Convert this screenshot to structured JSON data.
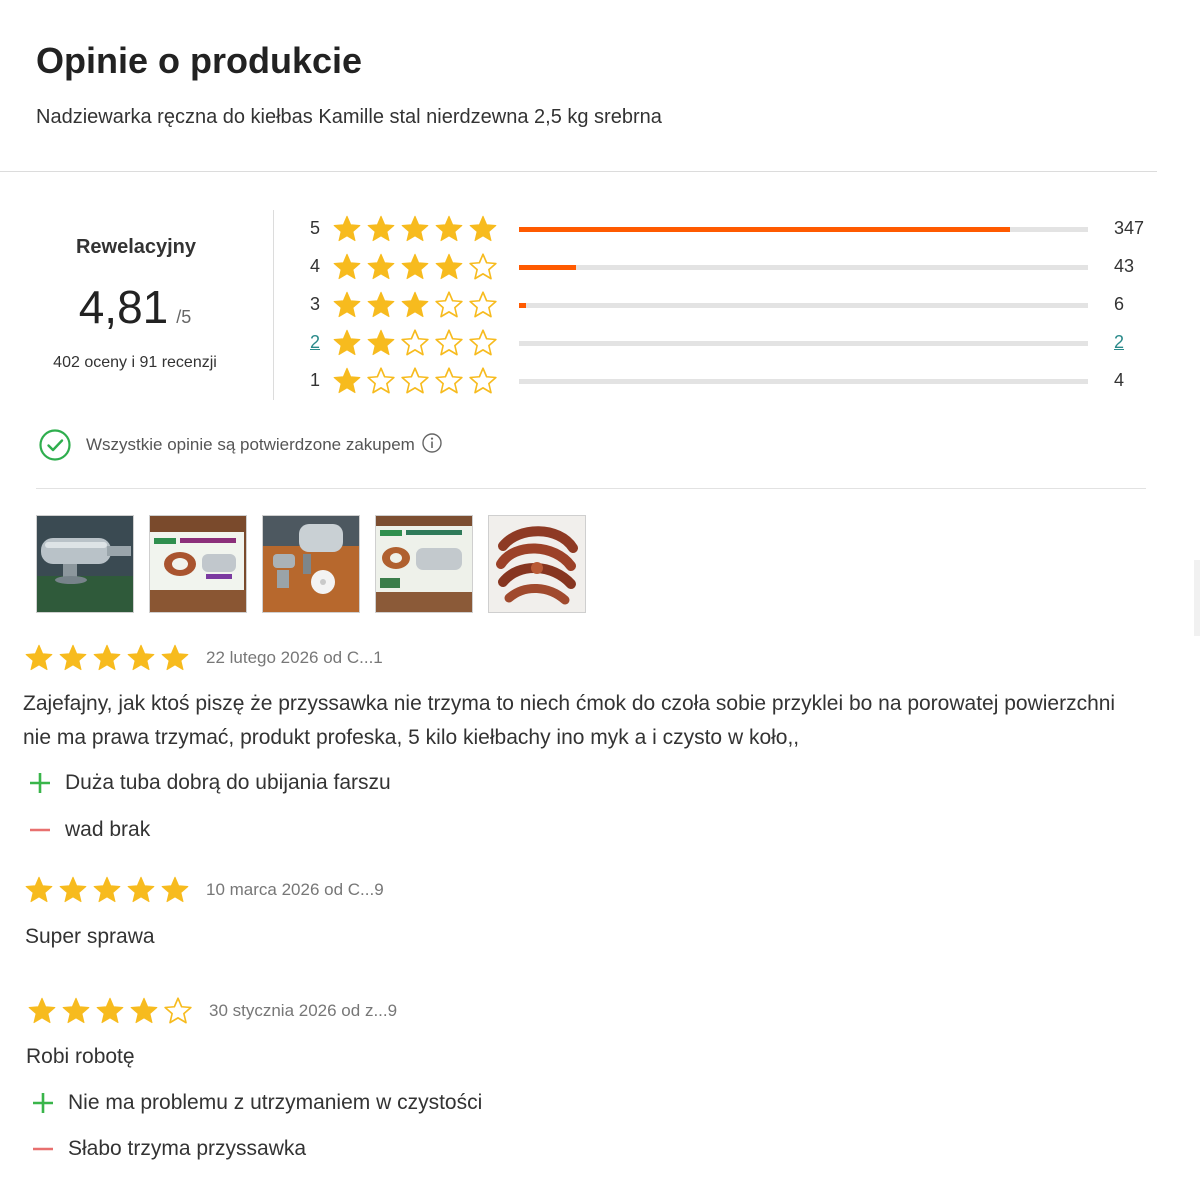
{
  "header": {
    "title": "Opinie o produkcie",
    "product_name": "Nadziewarka ręczna do kiełbas Kamille stal nierdzewna 2,5 kg srebrna"
  },
  "summary": {
    "verdict": "Rewelacyjny",
    "score": "4,81",
    "score_max": "/5",
    "counts": "402 oceny i 91 recenzji"
  },
  "distribution": [
    {
      "stars": 5,
      "label": "5",
      "count": "347",
      "share": 0.863
    },
    {
      "stars": 4,
      "label": "4",
      "count": "43",
      "share": 0.1
    },
    {
      "stars": 3,
      "label": "3",
      "count": "6",
      "share": 0.012
    },
    {
      "stars": 2,
      "label": "2",
      "count": "2",
      "share": 0.0,
      "linked": true
    },
    {
      "stars": 1,
      "label": "1",
      "count": "4",
      "share": 0.0
    }
  ],
  "verified": {
    "text": "Wszystkie opinie są potwierdzone zakupem",
    "icon": "check-circle-icon",
    "info_icon": "info-icon"
  },
  "photos": [
    {
      "name": "photo-sausage-stuffer-steel"
    },
    {
      "name": "photo-product-box-front"
    },
    {
      "name": "photo-stuffer-parts-on-table"
    },
    {
      "name": "photo-product-box-side"
    },
    {
      "name": "photo-homemade-sausages"
    }
  ],
  "reviews": [
    {
      "rating": 5,
      "meta": "22 lutego 2026 od C...1",
      "text": "Zajefajny, jak ktoś piszę że przyssawka nie trzyma to niech ćmok do czoła sobie przyklei bo na porowatej powierzchni nie ma prawa trzymać, produkt profeska, 5 kilo kiełbachy ino myk a i czysto w koło,,",
      "pro": "Duża tuba dobrą do ubijania farszu",
      "con": "wad brak"
    },
    {
      "rating": 5,
      "meta": "10 marca 2026 od C...9",
      "text": "Super sprawa"
    },
    {
      "rating": 4,
      "meta": "30 stycznia 2026 od z...9",
      "text": "Robi robotę",
      "pro": "Nie ma problemu z utrzymaniem w czystości",
      "con": "Słabo trzyma przyssawka"
    }
  ],
  "colors": {
    "star": "#f7bb1e",
    "bar_fill": "#ff5a00",
    "bar_track": "#e3e3e3",
    "pro_sign": "#39b54a",
    "con_sign": "#e8706f",
    "link": "#2a8a8a",
    "verified_check": "#2fae4e"
  }
}
